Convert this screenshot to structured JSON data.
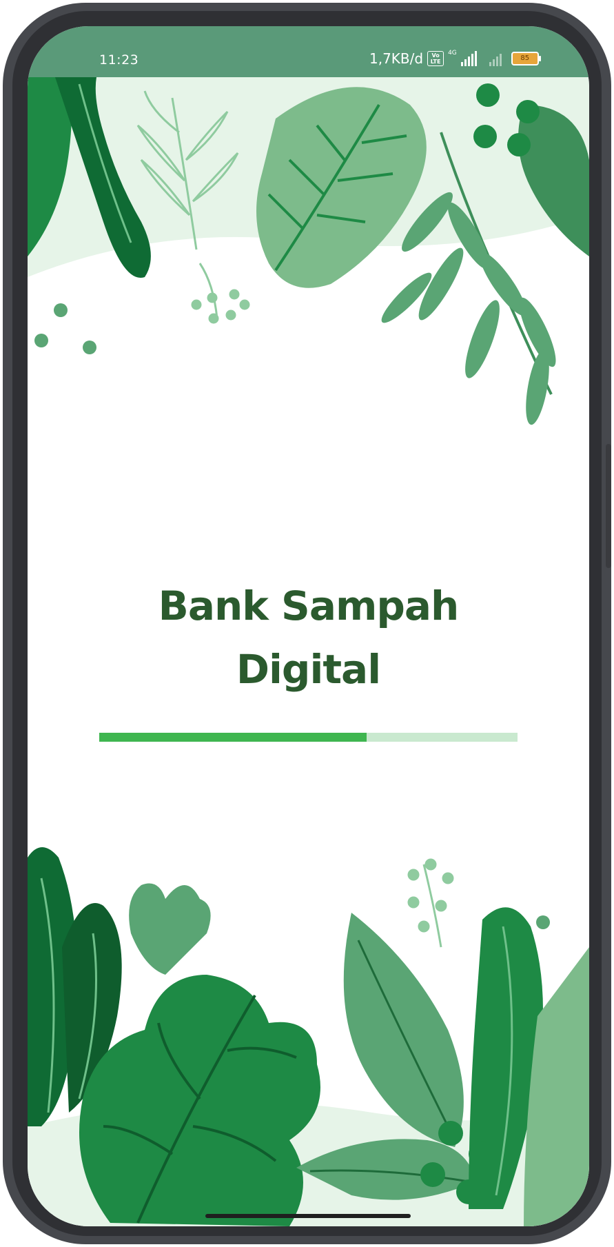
{
  "status_bar": {
    "time": "11:23",
    "net_speed": "1,7KB/d",
    "volte_top": "Vo",
    "volte_bottom": "LTE",
    "network": "4G",
    "battery": "85"
  },
  "app": {
    "title_line1": "Bank Sampah",
    "title_line2": "Digital"
  },
  "loading": {
    "progress": 0.64
  },
  "colors": {
    "title": "#2b5a2e",
    "progress_fill": "#3fb650",
    "progress_track": "#c9e9cf",
    "status_bar": "#5a9a79"
  }
}
